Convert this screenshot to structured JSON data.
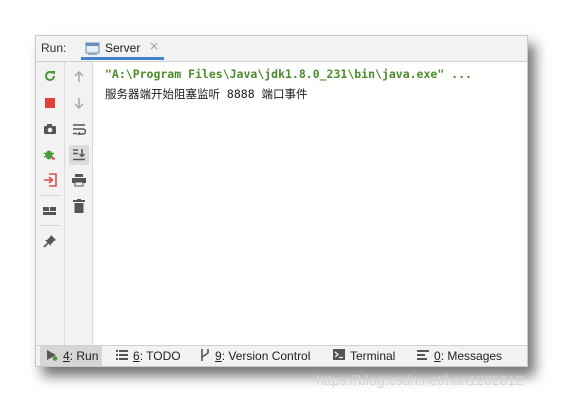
{
  "run_header": {
    "label": "Run:",
    "tab": {
      "label": "Server",
      "close": "×",
      "icon": "server-console-icon"
    }
  },
  "toolbar_left": [
    {
      "name": "rerun-icon",
      "color": "#4a9a36"
    },
    {
      "name": "stop-icon",
      "color": "#e0423a"
    },
    {
      "name": "camera-icon",
      "color": "#555555"
    },
    {
      "name": "debug-bug-icon",
      "color": "#4a9a36"
    },
    {
      "name": "login-arrow-icon",
      "color": "#d9534f"
    },
    {
      "name": "layout-icon",
      "color": "#555555"
    },
    {
      "name": "pin-icon",
      "color": "#555555"
    }
  ],
  "toolbar_right": [
    {
      "name": "arrow-up-icon"
    },
    {
      "name": "arrow-down-icon"
    },
    {
      "name": "soft-wrap-icon"
    },
    {
      "name": "scroll-to-end-icon"
    },
    {
      "name": "print-icon"
    },
    {
      "name": "trash-icon"
    }
  ],
  "console": {
    "command_line": "\"A:\\Program Files\\Java\\jdk1.8.0_231\\bin\\java.exe\" ...",
    "output_line": "服务器端开始阻塞监听 8888 端口事件"
  },
  "bottom_bar": {
    "run": {
      "key": "4",
      "label": ": Run"
    },
    "todo": {
      "key": "6",
      "label": ": TODO"
    },
    "vcs": {
      "key": "9",
      "label": ": Version Control"
    },
    "terminal": {
      "label": "Terminal"
    },
    "messages": {
      "key": "0",
      "label": ": Messages"
    }
  },
  "watermark": "https://blog.csdn.net/han1202012",
  "colors": {
    "accent": "#4083c9",
    "command_text": "#4c8b2b",
    "panel_bg": "#f2f2f2"
  }
}
